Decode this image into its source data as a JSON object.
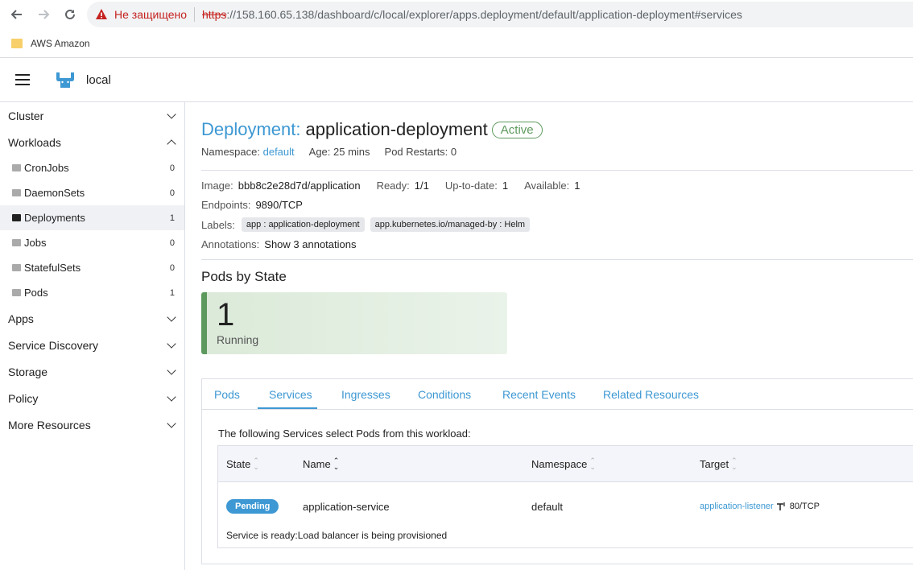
{
  "browser": {
    "insecure_label": "Не защищено",
    "url_scheme": "https",
    "url_rest": "://158.160.65.138/dashboard/c/local/explorer/apps.deployment/default/application-deployment#services",
    "bookmark": "AWS Amazon"
  },
  "header": {
    "cluster_name": "local"
  },
  "sidebar": {
    "groups": {
      "cluster": "Cluster",
      "workloads": "Workloads",
      "apps": "Apps",
      "service_discovery": "Service Discovery",
      "storage": "Storage",
      "policy": "Policy",
      "more_resources": "More Resources"
    },
    "items": [
      {
        "label": "CronJobs",
        "count": "0"
      },
      {
        "label": "DaemonSets",
        "count": "0"
      },
      {
        "label": "Deployments",
        "count": "1"
      },
      {
        "label": "Jobs",
        "count": "0"
      },
      {
        "label": "StatefulSets",
        "count": "0"
      },
      {
        "label": "Pods",
        "count": "1"
      }
    ]
  },
  "detail": {
    "type": "Deployment:",
    "name": "application-deployment",
    "status": "Active",
    "namespace_label": "Namespace:",
    "namespace": "default",
    "age": "Age: 25 mins",
    "restarts": "Pod Restarts: 0",
    "image_label": "Image:",
    "image": "bbb8c2e28d7d/application",
    "ready_label": "Ready:",
    "ready": "1/1",
    "uptodate_label": "Up-to-date:",
    "uptodate": "1",
    "available_label": "Available:",
    "available": "1",
    "endpoints_label": "Endpoints:",
    "endpoints": "9890/TCP",
    "labels_label": "Labels:",
    "labels": [
      "app : application-deployment",
      "app.kubernetes.io/managed-by : Helm"
    ],
    "annotations_label": "Annotations:",
    "annotations_link": "Show 3 annotations"
  },
  "pods_by_state": {
    "title": "Pods by State",
    "count": "1",
    "state": "Running"
  },
  "tabs": [
    "Pods",
    "Services",
    "Ingresses",
    "Conditions",
    "Recent Events",
    "Related Resources"
  ],
  "services": {
    "description": "The following Services select Pods from this workload:",
    "headers": {
      "state": "State",
      "name": "Name",
      "namespace": "Namespace",
      "target": "Target"
    },
    "row": {
      "state": "Pending",
      "name": "application-service",
      "namespace": "default",
      "target_name": "application-listener",
      "target_port": "80/TCP",
      "message": "Service is ready:Load balancer is being provisioned"
    }
  },
  "colors": {
    "accent": "#3d98d3",
    "success": "#5d995d",
    "insecure": "#c5221f"
  }
}
